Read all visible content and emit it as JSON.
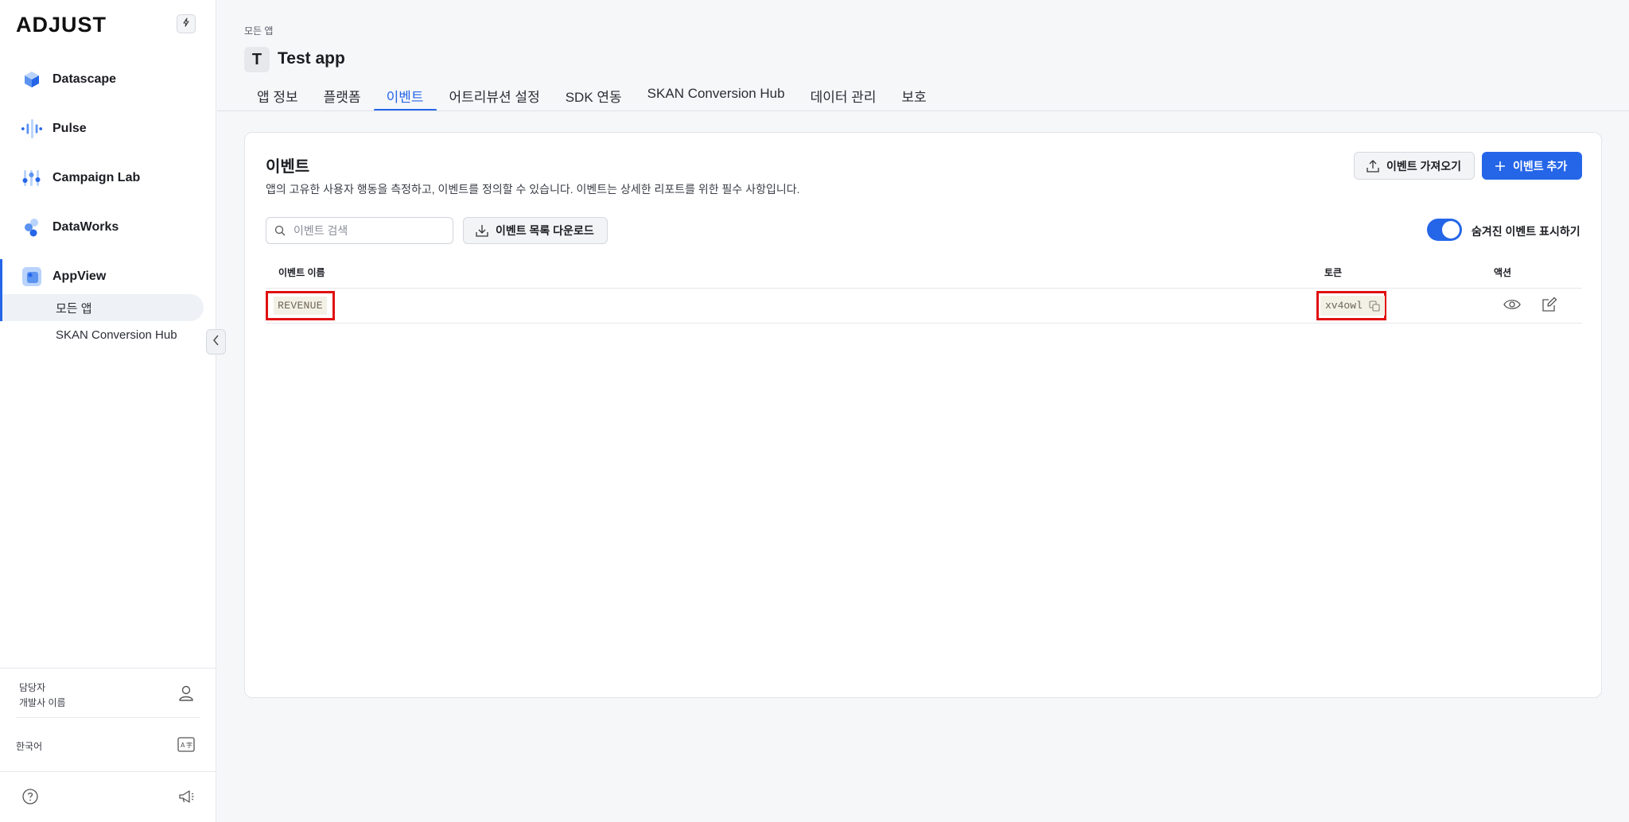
{
  "sidebar": {
    "logo": "ADJUST",
    "nav": [
      {
        "label": "Datascape",
        "icon": "datascape-icon"
      },
      {
        "label": "Pulse",
        "icon": "pulse-icon"
      },
      {
        "label": "Campaign Lab",
        "icon": "campaign-lab-icon"
      },
      {
        "label": "DataWorks",
        "icon": "dataworks-icon"
      },
      {
        "label": "AppView",
        "icon": "appview-icon"
      }
    ],
    "sub_items": [
      {
        "label": "모든 앱"
      },
      {
        "label": "SKAN Conversion Hub"
      }
    ],
    "account": {
      "role": "담당자",
      "name": "개발사 이름"
    },
    "language": "한국어"
  },
  "header": {
    "breadcrumb": "모든 앱",
    "app_initial": "T",
    "app_title": "Test app",
    "tabs": [
      {
        "label": "앱 정보"
      },
      {
        "label": "플랫폼"
      },
      {
        "label": "이벤트"
      },
      {
        "label": "어트리뷰션 설정"
      },
      {
        "label": "SDK 연동"
      },
      {
        "label": "SKAN Conversion Hub"
      },
      {
        "label": "데이터 관리"
      },
      {
        "label": "보호"
      }
    ],
    "active_tab": "이벤트"
  },
  "events": {
    "title": "이벤트",
    "description": "앱의 고유한 사용자 행동을 측정하고, 이벤트를 정의할 수 있습니다. 이벤트는 상세한 리포트를 위한 필수 사항입니다.",
    "import_label": "이벤트 가져오기",
    "add_label": "이벤트 추가",
    "search_placeholder": "이벤트 검색",
    "download_label": "이벤트 목록 다운로드",
    "show_hidden_label": "숨겨진 이벤트 표시하기",
    "show_hidden_on": true,
    "columns": {
      "name": "이벤트 이름",
      "token": "토큰",
      "actions": "액션"
    },
    "rows": [
      {
        "name": "REVENUE",
        "token": "xv4owl"
      }
    ]
  },
  "colors": {
    "accent": "#2566e8",
    "highlight": "#e01010"
  }
}
